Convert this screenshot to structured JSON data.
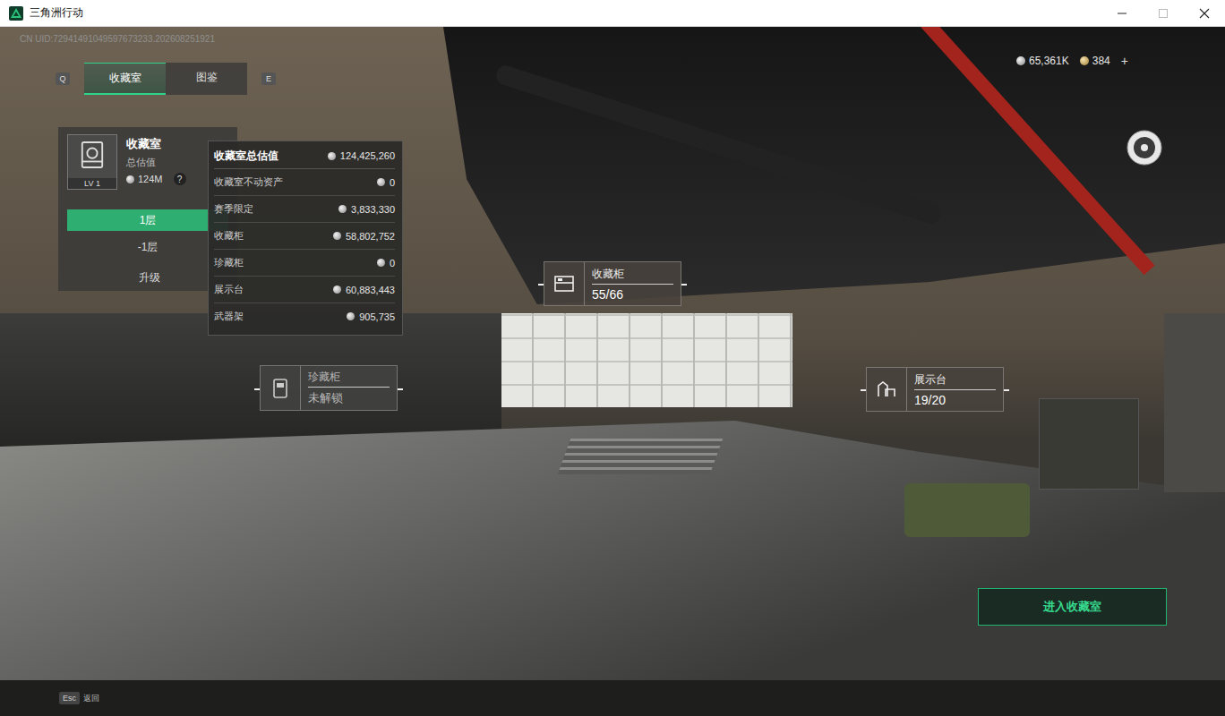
{
  "window": {
    "title": "三角洲行动"
  },
  "uid": "CN UID:72941491049597673233.202608251921",
  "tab_bar": {
    "prev_key": "Q",
    "next_key": "E",
    "tabs": [
      {
        "label": "收藏室",
        "selected": true
      },
      {
        "label": "图鉴",
        "selected": false
      }
    ]
  },
  "currencies": [
    {
      "kind": "coin",
      "amount": "65,361K"
    },
    {
      "kind": "gem",
      "amount": "384"
    }
  ],
  "add_button": "+",
  "room_panel": {
    "title": "收藏室",
    "subtitle": "总估值",
    "level": "LV 1",
    "value": "124M",
    "help": "?",
    "floors": [
      {
        "label": "1层",
        "selected": true
      },
      {
        "label": "-1层",
        "selected": false
      }
    ],
    "upgrade": "升级"
  },
  "value_tooltip": {
    "title": "收藏室总估值",
    "total": "124,425,260",
    "rows": [
      {
        "label": "收藏室不动资产",
        "value": "0"
      },
      {
        "label": "赛季限定",
        "value": "3,833,330"
      },
      {
        "label": "收藏柜",
        "value": "58,802,752"
      },
      {
        "label": "珍藏柜",
        "value": "0"
      },
      {
        "label": "展示台",
        "value": "60,883,443"
      },
      {
        "label": "武器架",
        "value": "905,735"
      }
    ]
  },
  "markers": [
    {
      "kind": "cabinet",
      "label": "收藏柜",
      "value": "55/66",
      "locked": false
    },
    {
      "kind": "vault",
      "label": "珍藏柜",
      "value": "未解锁",
      "locked": true
    },
    {
      "kind": "stand",
      "label": "展示台",
      "value": "19/20",
      "locked": false
    }
  ],
  "enter_button": "进入收藏室",
  "footer": {
    "key": "Esc",
    "label": "返回"
  }
}
